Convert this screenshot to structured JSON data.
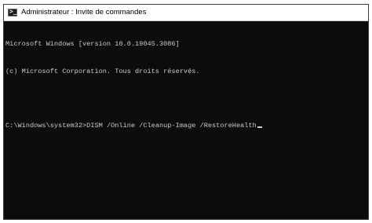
{
  "window": {
    "title": "Administrateur : Invite de commandes",
    "icon": "command-prompt-icon"
  },
  "console": {
    "lines": [
      "Microsoft Windows [version 10.0.19045.3086]",
      "(c) Microsoft Corporation. Tous droits réservés."
    ],
    "prompt": "C:\\Windows\\system32>",
    "command": "DISM /Online /Cleanup-Image /RestoreHealth"
  },
  "colors": {
    "console_bg": "#0c0c0c",
    "console_text": "#cccccc",
    "titlebar_bg": "#ffffff"
  }
}
